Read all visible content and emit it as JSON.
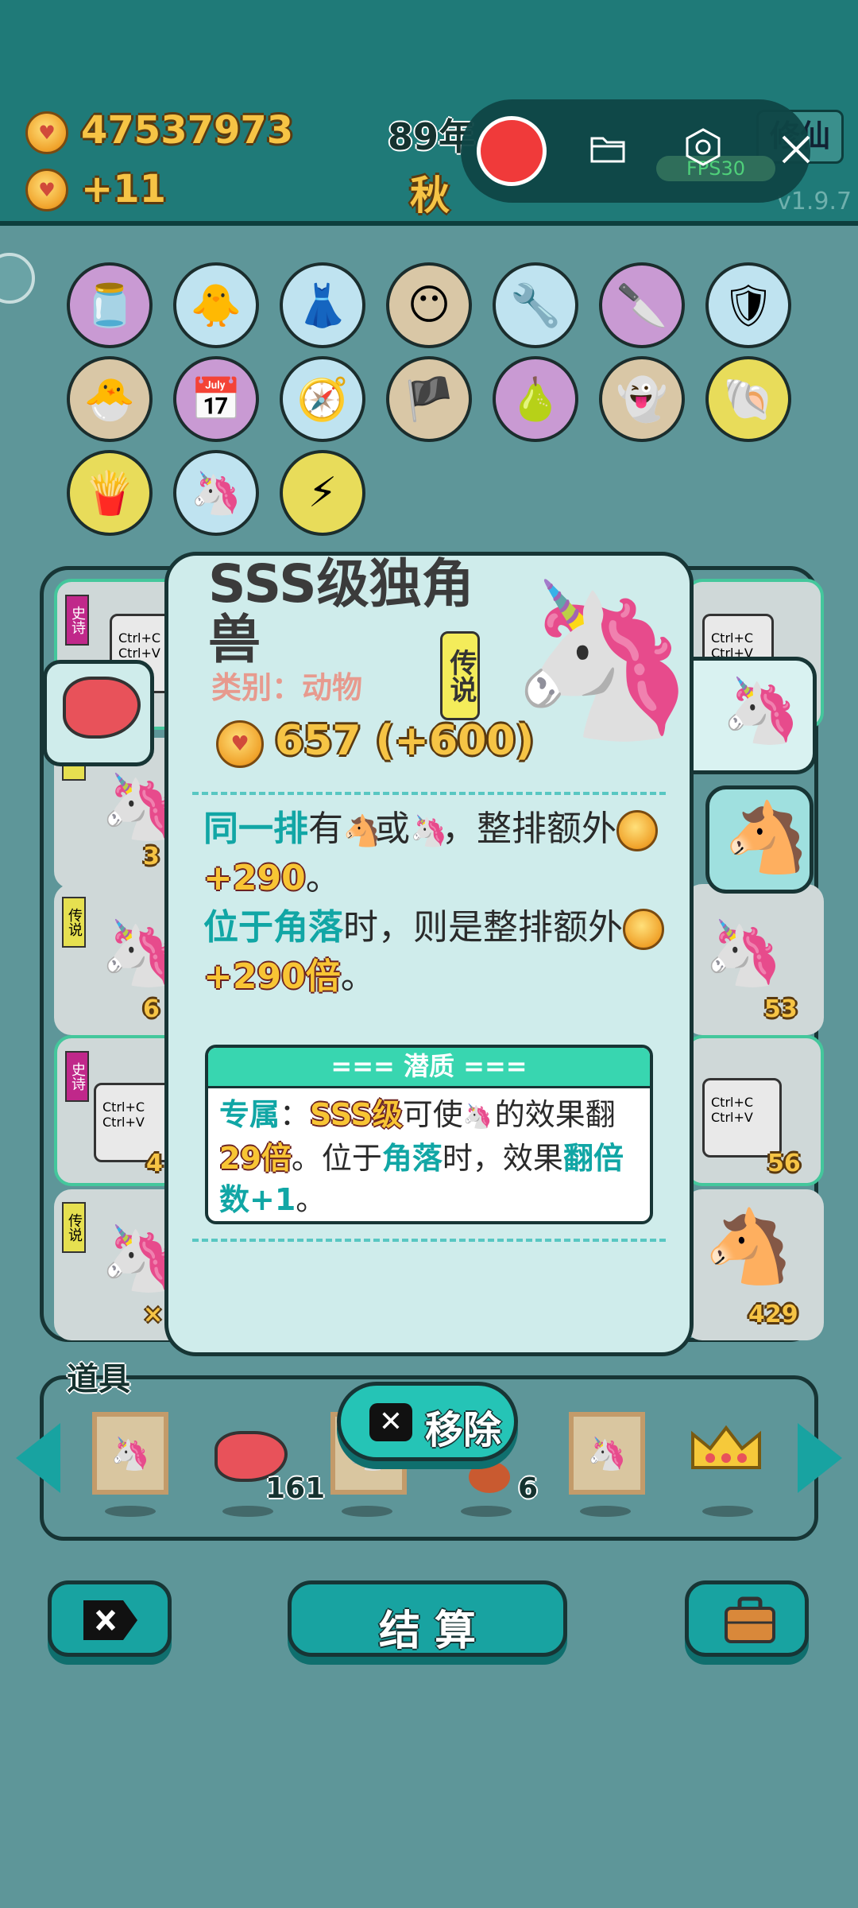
{
  "top_bar": {
    "coins": "47537973",
    "coin_gain": "+11",
    "year": "89年",
    "season": "秋",
    "xiuxian_label": "修仙",
    "fps_label": "FPS30",
    "version": "v1.9.7"
  },
  "recorder": {
    "record_icon": "record-icon",
    "folder_icon": "folder-icon",
    "settings_icon": "settings-icon",
    "close_icon": "close-icon"
  },
  "owned_items": [
    {
      "name": "jar",
      "icon": "🫙",
      "bg": "#c99ad3"
    },
    {
      "name": "chick-egg",
      "icon": "🐥",
      "bg": "#bfe3f0"
    },
    {
      "name": "skirt",
      "icon": "👗",
      "bg": "#bfe3f0"
    },
    {
      "name": "mask",
      "icon": "😶",
      "bg": "#d9c7a6"
    },
    {
      "name": "pump",
      "icon": "🔧",
      "bg": "#bfe3f0"
    },
    {
      "name": "cleaver",
      "icon": "🔪",
      "bg": "#c99ad3"
    },
    {
      "name": "shield",
      "icon": "🛡",
      "bg": "#bfe3f0"
    },
    {
      "name": "chick-egg-2",
      "icon": "🐣",
      "bg": "#d9c7a6"
    },
    {
      "name": "calendar",
      "icon": "📅",
      "bg": "#c99ad3"
    },
    {
      "name": "compass",
      "icon": "🧭",
      "bg": "#bfe3f0"
    },
    {
      "name": "eyepatch",
      "icon": "🏴",
      "bg": "#d9c7a6"
    },
    {
      "name": "pomelo",
      "icon": "🍐",
      "bg": "#c99ad3"
    },
    {
      "name": "ghost",
      "icon": "👻",
      "bg": "#d9c7a6"
    },
    {
      "name": "shell",
      "icon": "🐚",
      "bg": "#e8dc5a"
    },
    {
      "name": "fries",
      "icon": "🍟",
      "bg": "#e8dc5a"
    },
    {
      "name": "twin-unicorn",
      "icon": "🦄",
      "bg": "#bfe3f0"
    },
    {
      "name": "lightning",
      "icon": "⚡",
      "bg": "#e8dc5a"
    }
  ],
  "board": {
    "left_tags": [
      "史诗",
      "传说",
      "传说",
      "史诗",
      "传说"
    ],
    "left_numbers": [
      "3",
      "6",
      "4",
      "×"
    ],
    "right_numbers": [
      "53",
      "56",
      "429"
    ],
    "ctrl_text": "Ctrl+C\nCtrl+V"
  },
  "modal": {
    "title": "SSS级独角兽",
    "category": "类别：动物",
    "rarity": "传说",
    "value": "657 (+600)",
    "desc": {
      "p1_a": "同一排",
      "p1_b": "有",
      "p1_c": "或",
      "p1_d": "，整排额外",
      "p1_e": "+290",
      "p1_f": "。",
      "p2_a": "位于角落",
      "p2_b": "时，则是整排额外",
      "p2_c": "+290倍",
      "p2_d": "。"
    },
    "potential": {
      "header": "=== 潜质 ===",
      "a": "专属",
      "b": "：",
      "c": "SSS级",
      "d": "可使",
      "e": "的效果翻",
      "f": "29倍",
      "g": "。位于",
      "h": "角落",
      "i": "时，效果",
      "j": "翻倍数+1",
      "k": "。"
    }
  },
  "tools": {
    "label": "道具",
    "remove_label": "移除",
    "counts": [
      "161",
      "6"
    ]
  },
  "bottom": {
    "settle_label": "结 算"
  },
  "colors": {
    "accent": "#18a3a1",
    "gold": "#f8c534",
    "modal_bg": "#cfeceb"
  }
}
